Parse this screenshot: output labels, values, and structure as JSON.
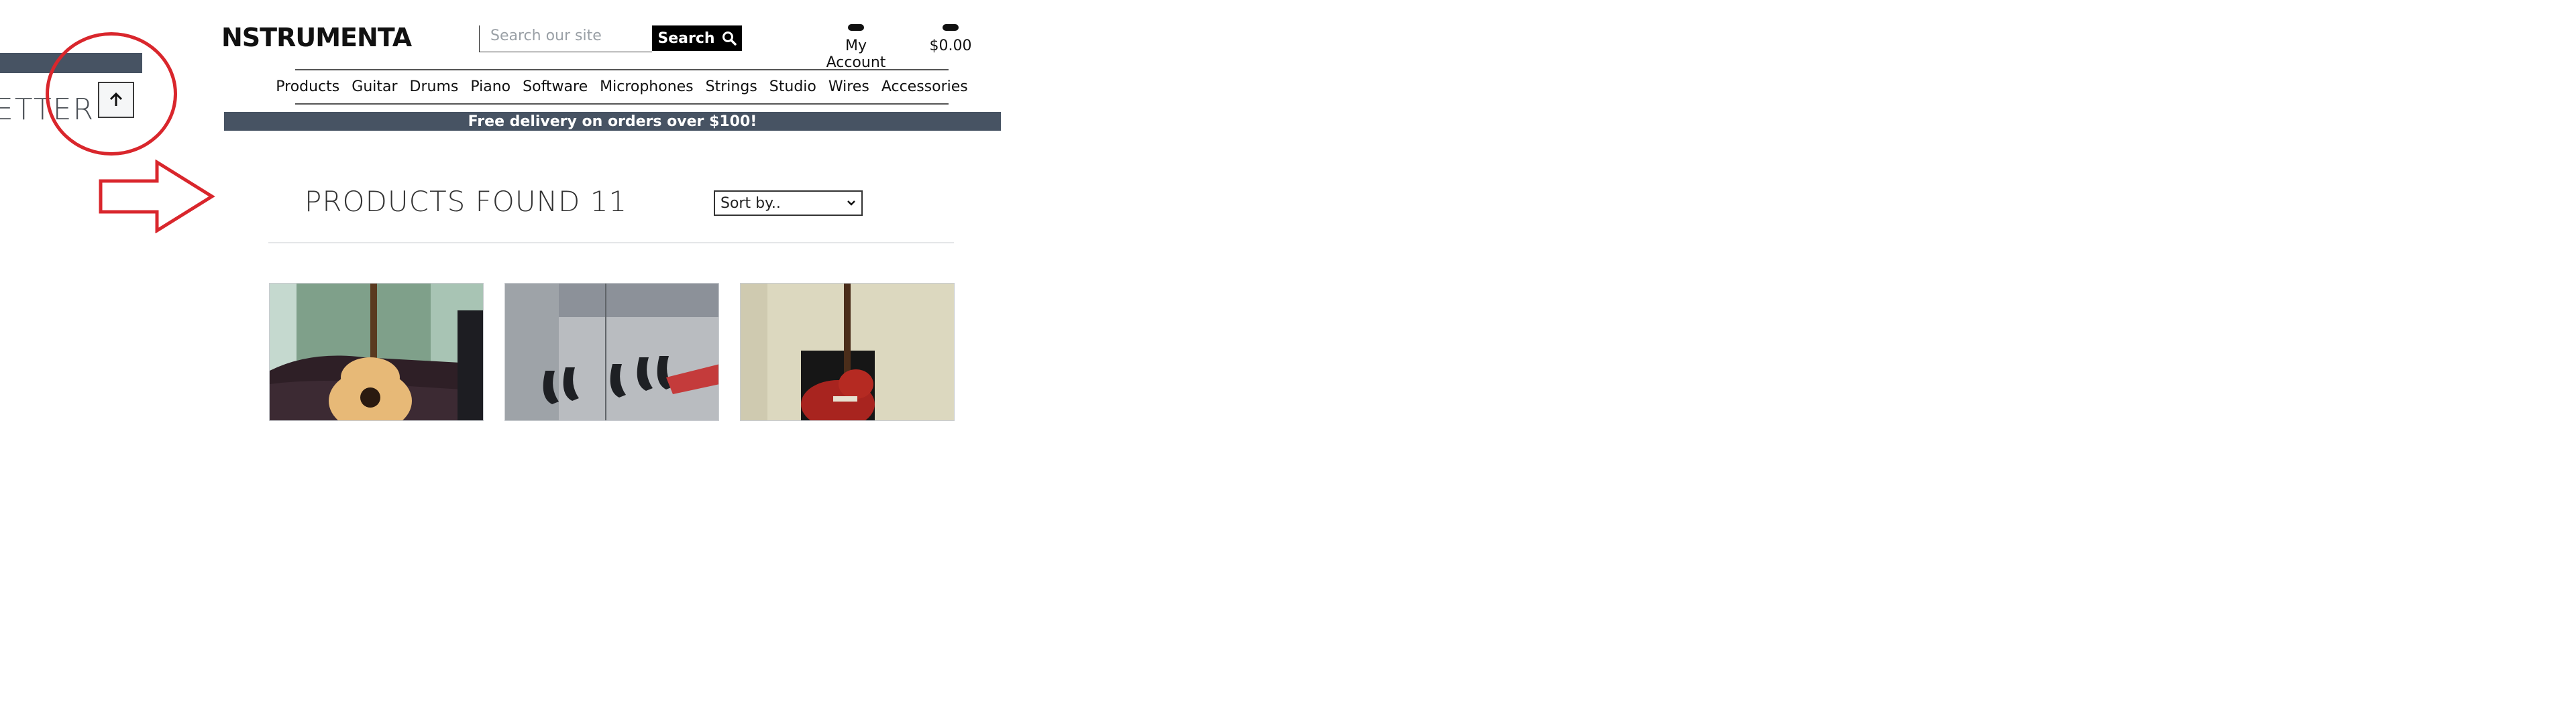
{
  "site": {
    "logo": "NSTRUMENTA"
  },
  "left_panel": {
    "newsletter_text": "ETTER"
  },
  "search": {
    "placeholder": "Search our site",
    "button_label": "Search"
  },
  "account": {
    "label": "My Account"
  },
  "cart": {
    "total": "$0.00"
  },
  "nav": {
    "items": [
      "Products",
      "Guitar",
      "Drums",
      "Piano",
      "Software",
      "Microphones",
      "Strings",
      "Studio",
      "Wires",
      "Accessories"
    ]
  },
  "promo": {
    "text": "Free delivery on orders over $100!"
  },
  "results": {
    "heading": "PRODUCTS FOUND 11"
  },
  "sort": {
    "selected": "Sort by.."
  },
  "products": [
    {
      "image_icon": "acoustic-guitar-photo"
    },
    {
      "image_icon": "guitar-wall-hangers-photo"
    },
    {
      "image_icon": "red-electric-guitar-photo"
    }
  ],
  "colors": {
    "promo_bar": "#475363",
    "annotation": "#d9262c",
    "button": "#000000"
  }
}
